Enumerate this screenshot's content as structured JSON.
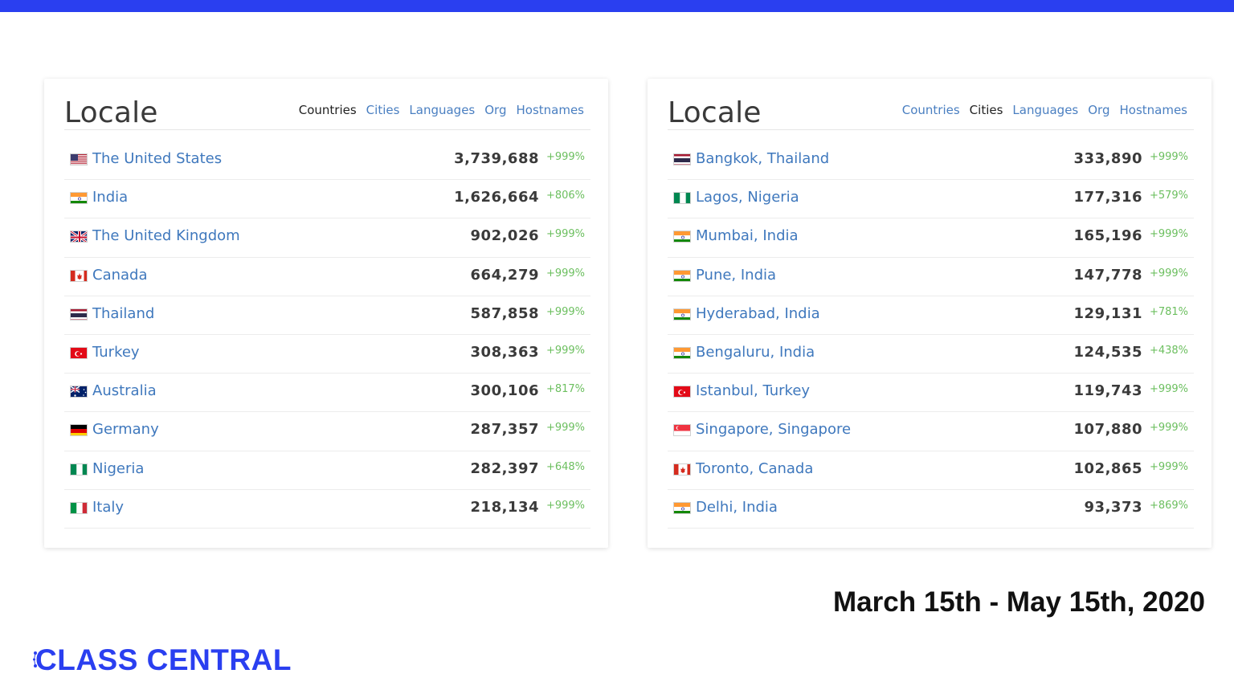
{
  "colors": {
    "accent": "#2a3ff0",
    "link": "#3f78bd",
    "positive": "#6cbf5f"
  },
  "left_panel": {
    "title": "Locale",
    "tabs": [
      {
        "label": "Countries",
        "active": true
      },
      {
        "label": "Cities",
        "active": false
      },
      {
        "label": "Languages",
        "active": false
      },
      {
        "label": "Org",
        "active": false
      },
      {
        "label": "Hostnames",
        "active": false
      }
    ],
    "rows": [
      {
        "name": "The United States",
        "value": "3,739,688",
        "change": "+999%",
        "flag": "us"
      },
      {
        "name": "India",
        "value": "1,626,664",
        "change": "+806%",
        "flag": "in"
      },
      {
        "name": "The United Kingdom",
        "value": "902,026",
        "change": "+999%",
        "flag": "gb"
      },
      {
        "name": "Canada",
        "value": "664,279",
        "change": "+999%",
        "flag": "ca"
      },
      {
        "name": "Thailand",
        "value": "587,858",
        "change": "+999%",
        "flag": "th"
      },
      {
        "name": "Turkey",
        "value": "308,363",
        "change": "+999%",
        "flag": "tr"
      },
      {
        "name": "Australia",
        "value": "300,106",
        "change": "+817%",
        "flag": "au"
      },
      {
        "name": "Germany",
        "value": "287,357",
        "change": "+999%",
        "flag": "de"
      },
      {
        "name": "Nigeria",
        "value": "282,397",
        "change": "+648%",
        "flag": "ng"
      },
      {
        "name": "Italy",
        "value": "218,134",
        "change": "+999%",
        "flag": "it"
      }
    ]
  },
  "right_panel": {
    "title": "Locale",
    "tabs": [
      {
        "label": "Countries",
        "active": false
      },
      {
        "label": "Cities",
        "active": true
      },
      {
        "label": "Languages",
        "active": false
      },
      {
        "label": "Org",
        "active": false
      },
      {
        "label": "Hostnames",
        "active": false
      }
    ],
    "rows": [
      {
        "name": "Bangkok, Thailand",
        "value": "333,890",
        "change": "+999%",
        "flag": "th"
      },
      {
        "name": "Lagos, Nigeria",
        "value": "177,316",
        "change": "+579%",
        "flag": "ng"
      },
      {
        "name": "Mumbai, India",
        "value": "165,196",
        "change": "+999%",
        "flag": "in"
      },
      {
        "name": "Pune, India",
        "value": "147,778",
        "change": "+999%",
        "flag": "in"
      },
      {
        "name": "Hyderabad, India",
        "value": "129,131",
        "change": "+781%",
        "flag": "in"
      },
      {
        "name": "Bengaluru, India",
        "value": "124,535",
        "change": "+438%",
        "flag": "in"
      },
      {
        "name": "Istanbul, Turkey",
        "value": "119,743",
        "change": "+999%",
        "flag": "tr"
      },
      {
        "name": "Singapore, Singapore",
        "value": "107,880",
        "change": "+999%",
        "flag": "sg"
      },
      {
        "name": "Toronto, Canada",
        "value": "102,865",
        "change": "+999%",
        "flag": "ca"
      },
      {
        "name": "Delhi, India",
        "value": "93,373",
        "change": "+869%",
        "flag": "in"
      }
    ]
  },
  "date_range": "March 15th - May 15th, 2020",
  "brand": {
    "name": "CLASS CENTRAL"
  }
}
